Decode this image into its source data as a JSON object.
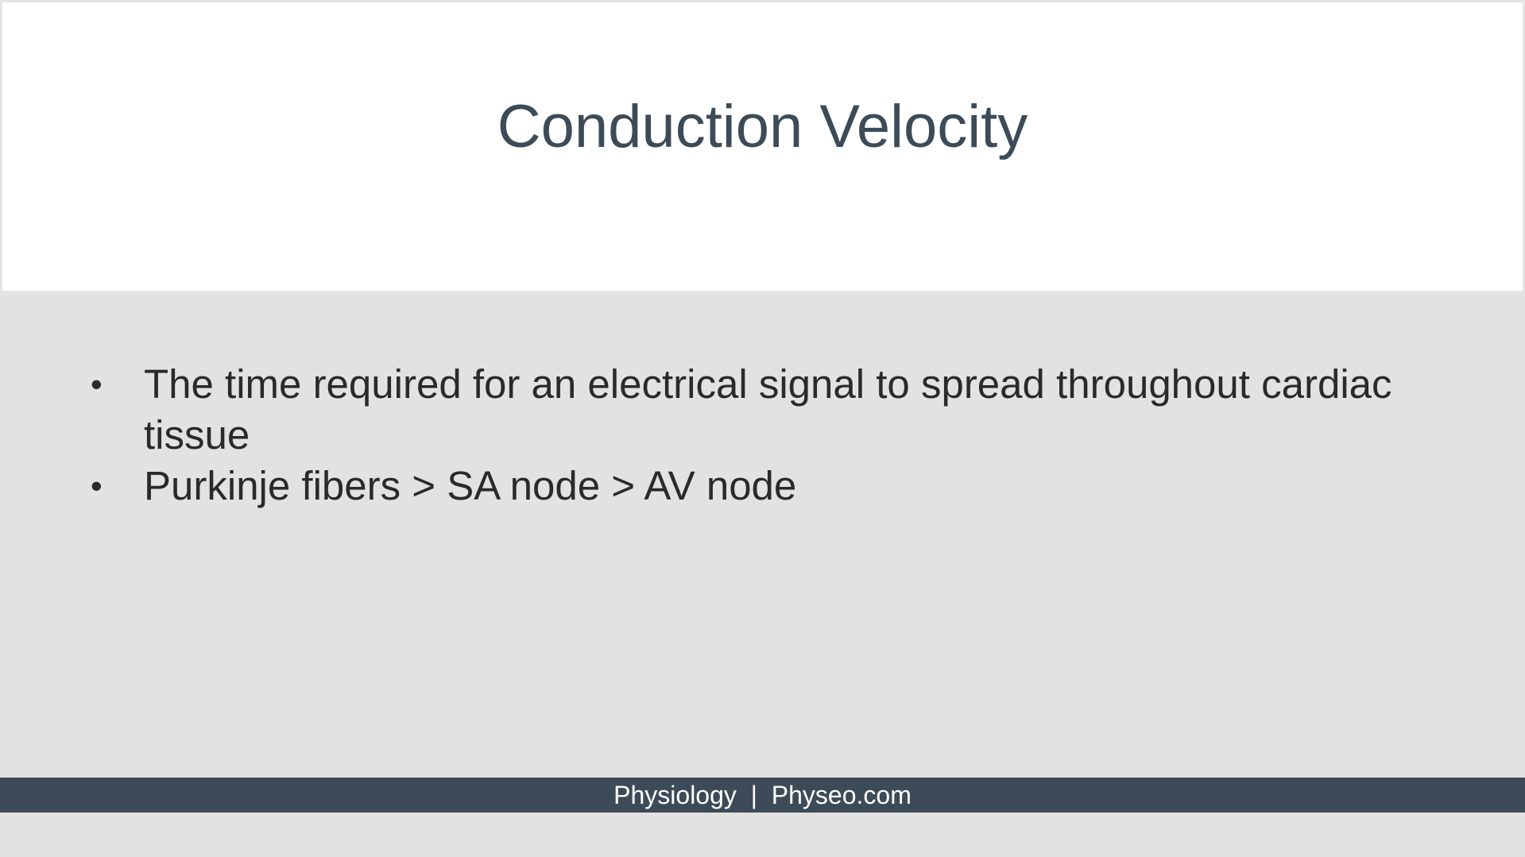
{
  "slide": {
    "title": "Conduction Velocity",
    "bullets": [
      "The time required for an electrical signal to spread throughout cardiac tissue",
      "Purkinje fibers > SA node > AV node"
    ],
    "bullet_symbol": "•",
    "footer": {
      "left": "Physiology",
      "separator": "|",
      "right": "Physeo.com"
    }
  },
  "colors": {
    "title_text": "#3c4b57",
    "footer_bg": "#3c4b57",
    "body_bg": "#e2e2e2",
    "body_text": "#2a2a2a"
  }
}
